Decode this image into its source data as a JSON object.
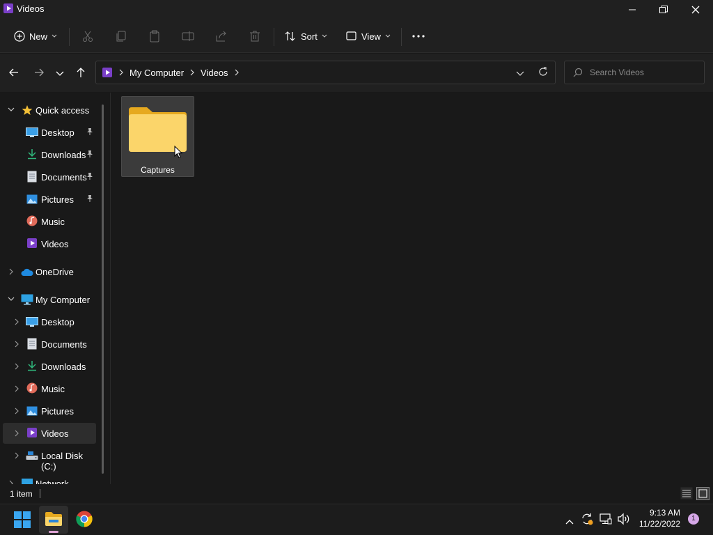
{
  "window": {
    "title": "Videos"
  },
  "toolbar": {
    "new_label": "New",
    "sort_label": "Sort",
    "view_label": "View"
  },
  "address": {
    "crumbs": [
      "My Computer",
      "Videos"
    ]
  },
  "search": {
    "placeholder": "Search Videos"
  },
  "nav": {
    "quick_access": "Quick access",
    "quick_items": [
      "Desktop",
      "Downloads",
      "Documents",
      "Pictures",
      "Music",
      "Videos"
    ],
    "onedrive": "OneDrive",
    "my_computer": "My Computer",
    "computer_items": [
      "Desktop",
      "Documents",
      "Downloads",
      "Music",
      "Pictures",
      "Videos",
      "Local Disk (C:)"
    ],
    "network": "Network"
  },
  "content": {
    "items": [
      {
        "name": "Captures"
      }
    ]
  },
  "status": {
    "item_count": "1 item"
  },
  "taskbar": {
    "time": "9:13 AM",
    "date": "11/22/2022",
    "notification_count": "1"
  },
  "colors": {
    "accent": "#0078d4",
    "folder": "#f8c93e",
    "video_purple": "#7a3fc8",
    "selected": "#2d2d2d"
  },
  "icons": [
    "videos-icon",
    "minimize-icon",
    "maximize-icon",
    "close-icon",
    "new-icon",
    "cut-icon",
    "copy-icon",
    "paste-icon",
    "rename-icon",
    "share-icon",
    "delete-icon",
    "sort-icon",
    "view-icon",
    "more-icon",
    "back-icon",
    "forward-icon",
    "up-icon",
    "refresh-icon",
    "search-icon",
    "star-icon",
    "desktop-icon",
    "download-icon",
    "document-icon",
    "pictures-icon",
    "music-icon",
    "onedrive-icon",
    "computer-icon",
    "disk-icon",
    "network-icon",
    "folder-icon",
    "windows-start-icon",
    "file-explorer-icon",
    "chrome-icon"
  ]
}
